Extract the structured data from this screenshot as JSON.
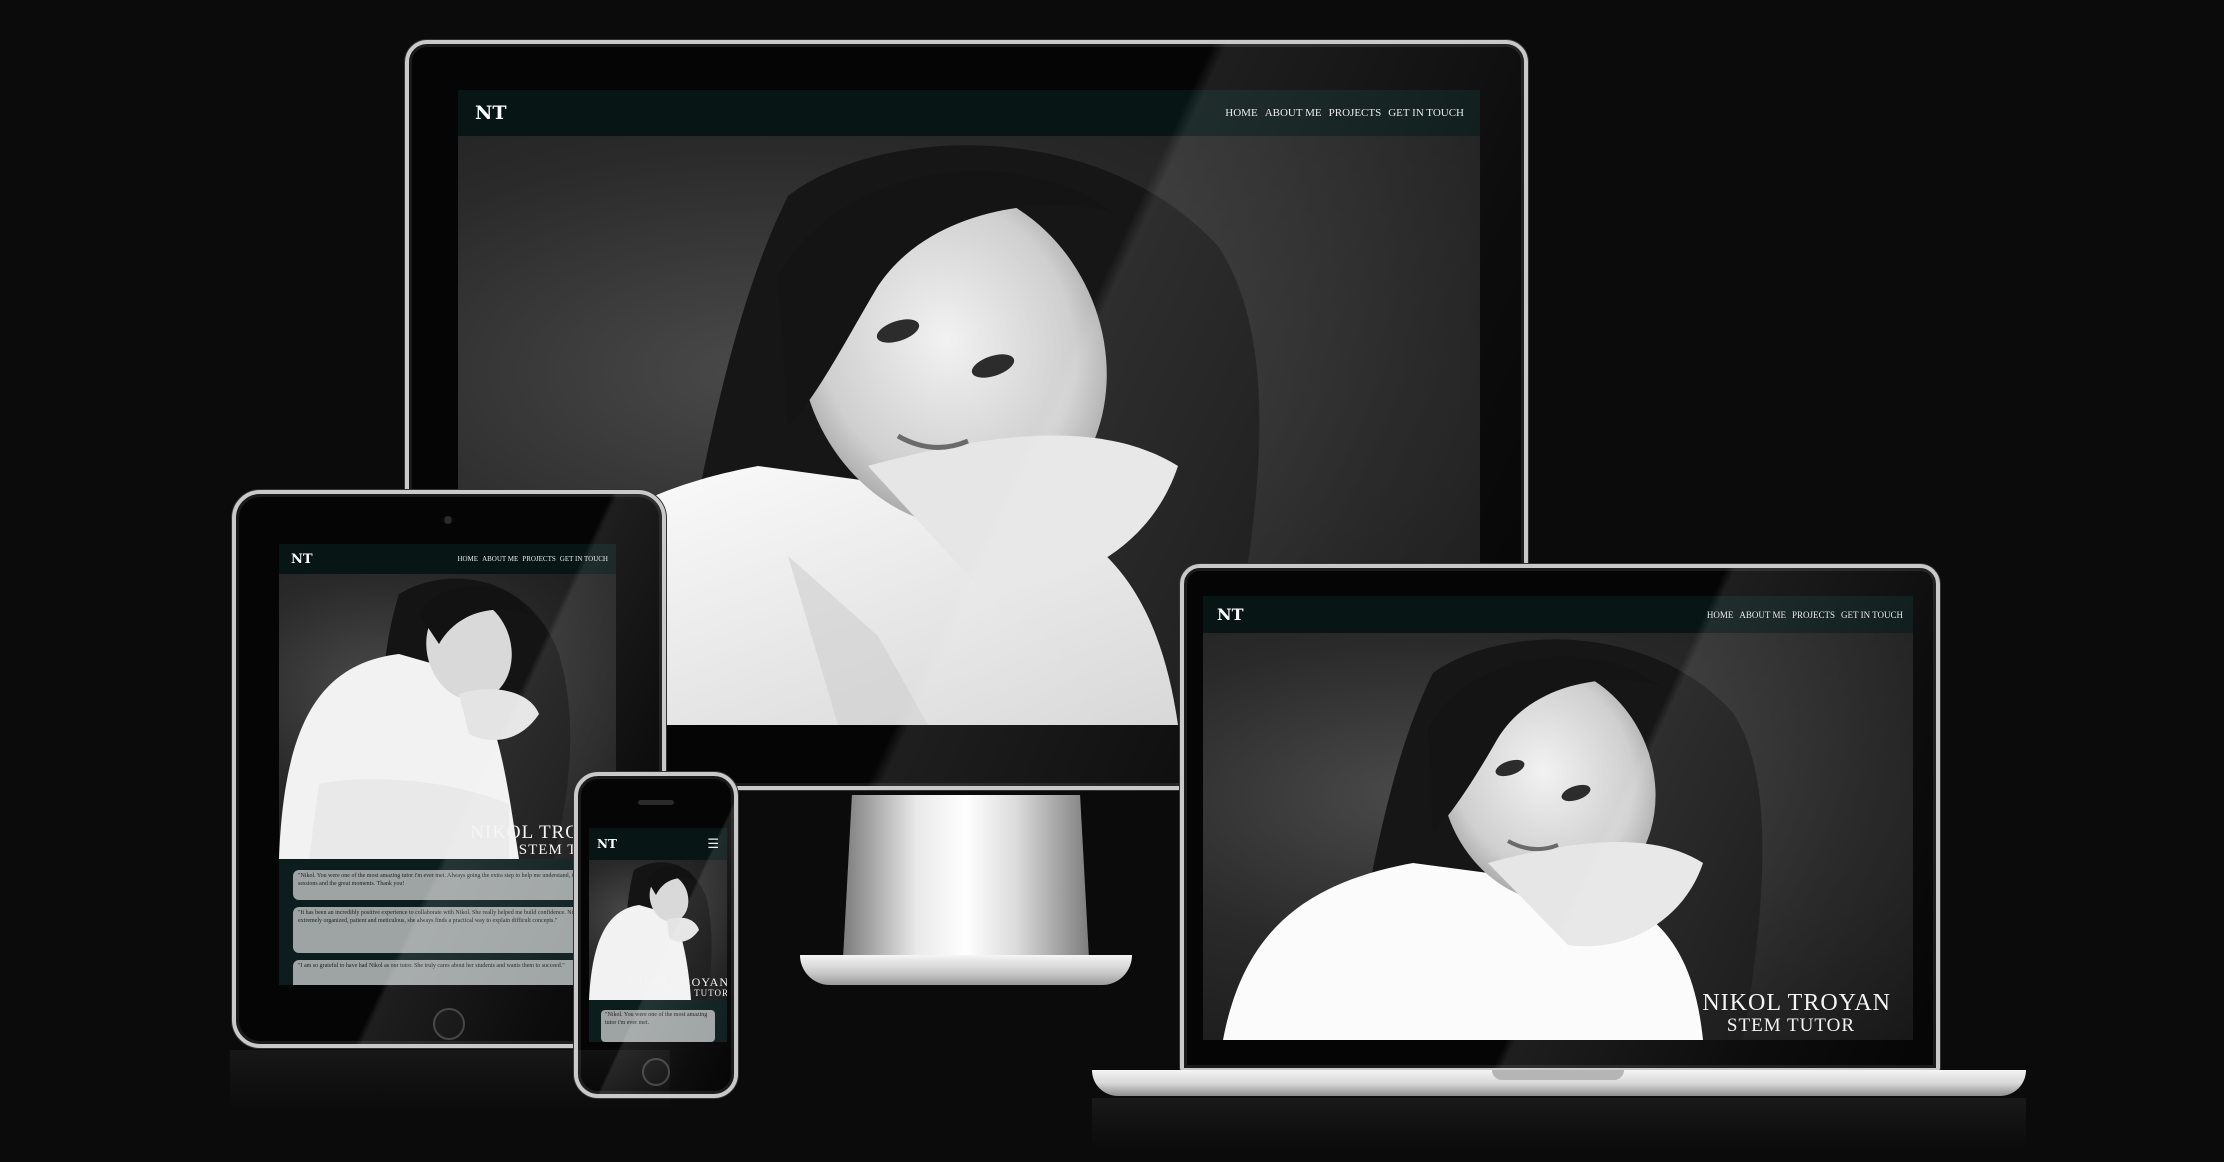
{
  "site": {
    "brand": "NT",
    "nav": [
      "HOME",
      "ABOUT ME",
      "PROJECTS",
      "GET IN TOUCH"
    ],
    "hero_name": "NIKOL TROYAN",
    "hero_role": "STEM TUTOR",
    "menu_icon": "hamburger-menu-icon"
  },
  "tablet": {
    "testimonials": [
      "\"Nikol. You were one of the most amazing tutor i'm ever met. Always going the extra step to help me understand, i will miss our sessions and the great moments. Thank you!",
      "\"It has been an incredibly positive experience to collaborate with Nikol. She really helped me build confidence. Nikol is extremely organized, patient and meticulous, she always finds a practical way to explain difficult concepts.\"",
      "\"I am so grateful to have had Nikol as our tutor. She truly cares about her students and wants them to succeed.\""
    ]
  },
  "phone": {
    "testimonial": "\"Nikol. You were one of the most amazing tutor i'm ever met."
  }
}
